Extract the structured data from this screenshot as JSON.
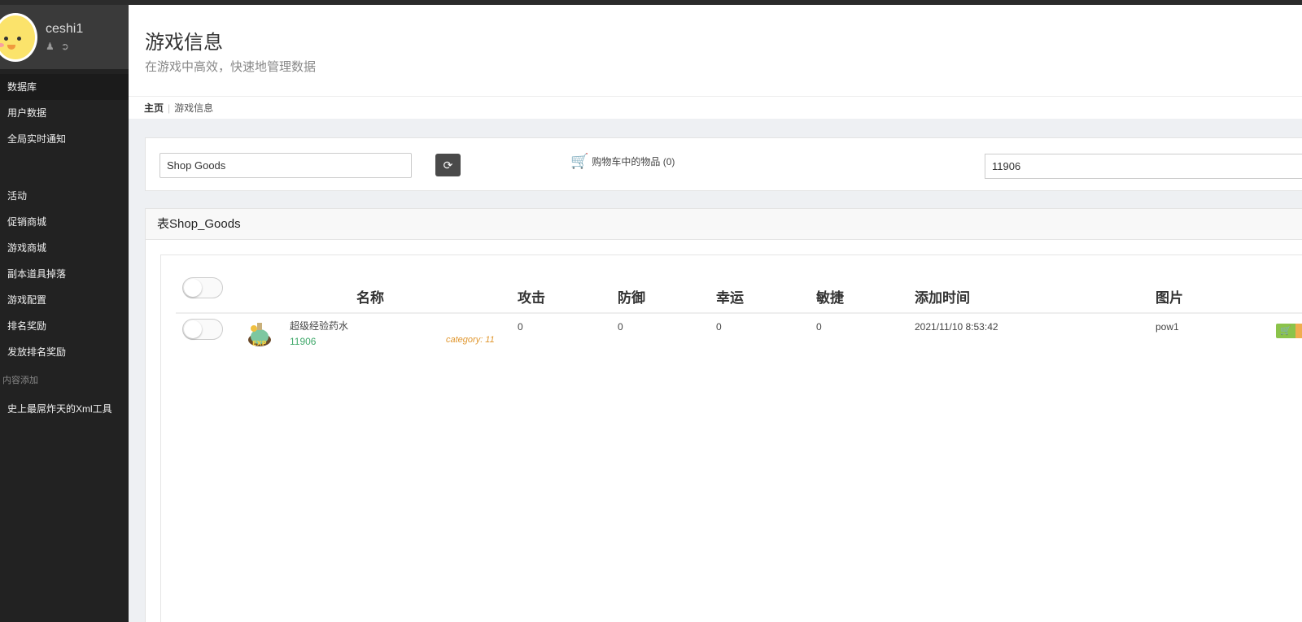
{
  "user": {
    "name": "ceshi1"
  },
  "sidebar": {
    "items": [
      {
        "label": "数据库",
        "active": true
      },
      {
        "label": "用户数据"
      },
      {
        "label": "全局实时通知"
      }
    ],
    "items2": [
      {
        "label": "活动"
      },
      {
        "label": "促销商城"
      },
      {
        "label": "游戏商城"
      },
      {
        "label": "副本道具掉落"
      },
      {
        "label": "游戏配置"
      },
      {
        "label": "排名奖励"
      },
      {
        "label": "发放排名奖励"
      }
    ],
    "section_content": "内容添加",
    "items3": [
      {
        "label": "史上最屌炸天的Xml工具"
      }
    ]
  },
  "header": {
    "title": "游戏信息",
    "subtitle": "在游戏中高效，快速地管理数据"
  },
  "breadcrumb": {
    "home": "主页",
    "current": "游戏信息"
  },
  "toolbar": {
    "table_value": "Shop Goods",
    "cart_label": "购物车中的物品 (0)",
    "search_value": "11906"
  },
  "panel": {
    "title": "表Shop_Goods"
  },
  "table": {
    "columns": [
      "名称",
      "攻击",
      "防御",
      "幸运",
      "敏捷",
      "添加时间",
      "图片"
    ],
    "rows": [
      {
        "name": "超级经验药水",
        "id": "11906",
        "category": "category: 11",
        "attack": "0",
        "defense": "0",
        "luck": "0",
        "agility": "0",
        "added": "2021/11/10 8:53:42",
        "pic": "pow1"
      }
    ]
  },
  "colors": {
    "sidebar": "#222222",
    "accent_green": "#8bc34a",
    "id_green": "#3fa86a",
    "category_orange": "#e0962d"
  }
}
